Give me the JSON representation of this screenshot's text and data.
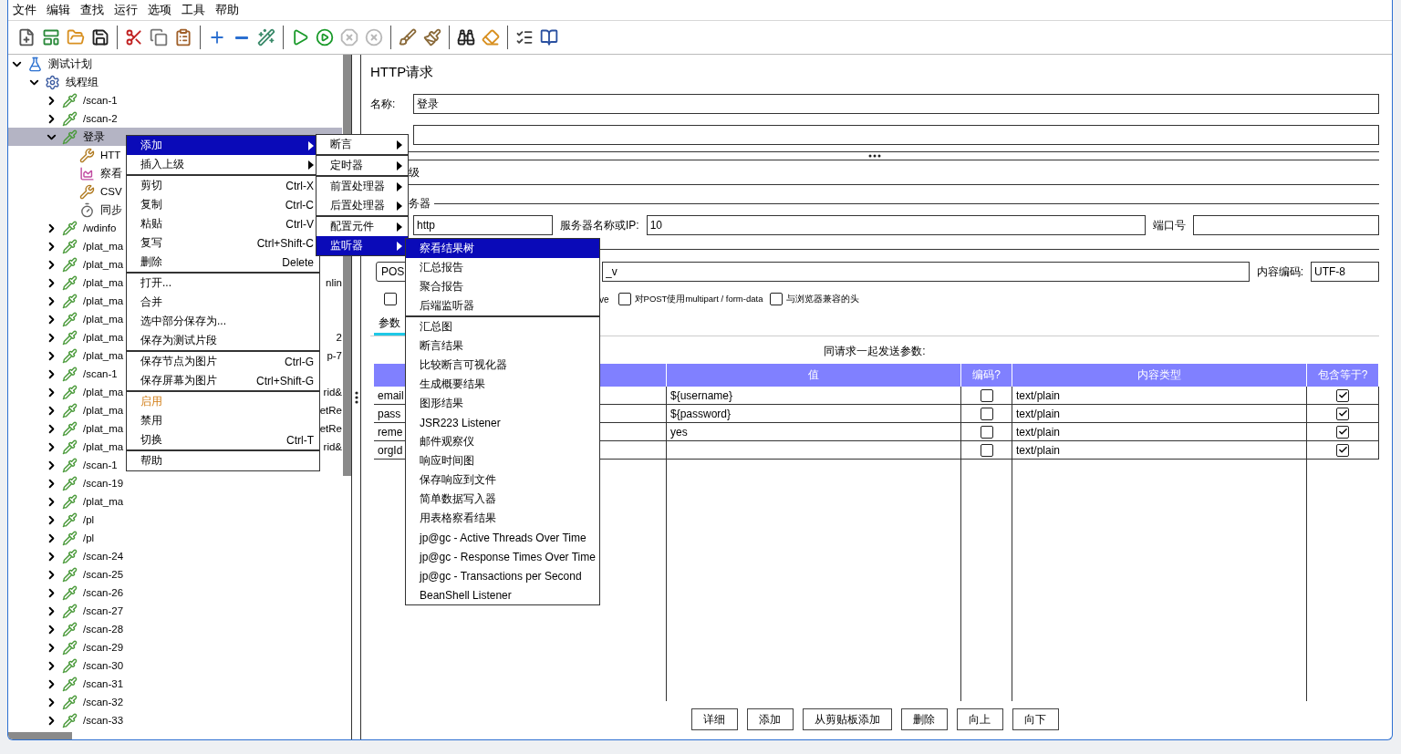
{
  "menu_bar": [
    "文件",
    "编辑",
    "查找",
    "运行",
    "选项",
    "工具",
    "帮助"
  ],
  "toolbar": {
    "groups": [
      [
        {
          "kind": "new",
          "disabled": false
        },
        {
          "kind": "templates",
          "disabled": false
        },
        {
          "kind": "open",
          "disabled": false
        },
        {
          "kind": "save",
          "disabled": false
        }
      ],
      [
        {
          "kind": "cut",
          "disabled": false
        },
        {
          "kind": "copy",
          "disabled": false
        },
        {
          "kind": "paste",
          "disabled": false
        }
      ],
      [
        {
          "kind": "expand",
          "disabled": false
        },
        {
          "kind": "collapse",
          "disabled": false
        },
        {
          "kind": "toggle",
          "disabled": false
        }
      ],
      [
        {
          "kind": "start",
          "disabled": false
        },
        {
          "kind": "start_no_timers",
          "disabled": false
        },
        {
          "kind": "stop",
          "disabled": true
        },
        {
          "kind": "shutdown",
          "disabled": true
        }
      ],
      [
        {
          "kind": "clear",
          "disabled": false
        },
        {
          "kind": "clear_all",
          "disabled": false
        }
      ],
      [
        {
          "kind": "search",
          "disabled": false
        },
        {
          "kind": "reset_search",
          "disabled": false
        }
      ],
      [
        {
          "kind": "functions",
          "disabled": false
        },
        {
          "kind": "help",
          "disabled": false
        }
      ]
    ]
  },
  "tree": [
    {
      "kind": "plan",
      "label": "测试计划",
      "expanded": true,
      "selected": false,
      "children": [
        {
          "kind": "threads",
          "label": "线程组",
          "expanded": true,
          "selected": false,
          "children": [
            {
              "kind": "sampler",
              "label": "/scan-1",
              "expanded": false,
              "selected": false
            },
            {
              "kind": "sampler",
              "label": "/scan-2",
              "expanded": false,
              "selected": false
            },
            {
              "kind": "sampler",
              "label": "登录",
              "expanded": true,
              "selected": true,
              "children": [
                {
                  "kind": "tool",
                  "label": "HTT",
                  "selected": false
                },
                {
                  "kind": "chart",
                  "label": "察看",
                  "selected": false
                },
                {
                  "kind": "tool",
                  "label": "CSV",
                  "selected": false
                },
                {
                  "kind": "timer",
                  "label": "同步",
                  "selected": false
                }
              ]
            },
            {
              "kind": "sampler",
              "label": "/wdinfo",
              "expanded": false,
              "selected": false
            },
            {
              "kind": "sampler",
              "label": "/plat_ma",
              "expanded": false,
              "selected": false
            },
            {
              "kind": "sampler",
              "label": "/plat_ma",
              "expanded": false,
              "selected": false
            },
            {
              "kind": "sampler",
              "label": "/plat_ma",
              "expanded": false,
              "selected": false,
              "tail": "nlin"
            },
            {
              "kind": "sampler",
              "label": "/plat_ma",
              "expanded": false,
              "selected": false
            },
            {
              "kind": "sampler",
              "label": "/plat_ma",
              "expanded": false,
              "selected": false
            },
            {
              "kind": "sampler",
              "label": "/plat_ma",
              "expanded": false,
              "selected": false,
              "tail": "2"
            },
            {
              "kind": "sampler",
              "label": "/plat_ma",
              "expanded": false,
              "selected": false,
              "tail": "p-7"
            },
            {
              "kind": "sampler",
              "label": "/scan-1",
              "expanded": false,
              "selected": false
            },
            {
              "kind": "sampler",
              "label": "/plat_ma",
              "expanded": false,
              "selected": false,
              "tail": "rid&"
            },
            {
              "kind": "sampler",
              "label": "/plat_ma",
              "expanded": false,
              "selected": false,
              "tail": "etRe"
            },
            {
              "kind": "sampler",
              "label": "/plat_ma",
              "expanded": false,
              "selected": false,
              "tail": "etRe"
            },
            {
              "kind": "sampler",
              "label": "/plat_ma",
              "expanded": false,
              "selected": false,
              "tail": "rid&"
            },
            {
              "kind": "sampler",
              "label": "/scan-1",
              "expanded": false,
              "selected": false
            },
            {
              "kind": "sampler",
              "label": "/scan-19",
              "expanded": false,
              "selected": false
            },
            {
              "kind": "sampler",
              "label": "/plat_ma",
              "expanded": false,
              "selected": false
            },
            {
              "kind": "sampler",
              "label": "/pl",
              "expanded": false,
              "selected": false
            },
            {
              "kind": "sampler",
              "label": "/pl",
              "expanded": false,
              "selected": false
            },
            {
              "kind": "sampler",
              "label": "/scan-24",
              "expanded": false,
              "selected": false
            },
            {
              "kind": "sampler",
              "label": "/scan-25",
              "expanded": false,
              "selected": false
            },
            {
              "kind": "sampler",
              "label": "/scan-26",
              "expanded": false,
              "selected": false
            },
            {
              "kind": "sampler",
              "label": "/scan-27",
              "expanded": false,
              "selected": false
            },
            {
              "kind": "sampler",
              "label": "/scan-28",
              "expanded": false,
              "selected": false
            },
            {
              "kind": "sampler",
              "label": "/scan-29",
              "expanded": false,
              "selected": false
            },
            {
              "kind": "sampler",
              "label": "/scan-30",
              "expanded": false,
              "selected": false
            },
            {
              "kind": "sampler",
              "label": "/scan-31",
              "expanded": false,
              "selected": false
            },
            {
              "kind": "sampler",
              "label": "/scan-32",
              "expanded": false,
              "selected": false
            },
            {
              "kind": "sampler",
              "label": "/scan-33",
              "expanded": false,
              "selected": false
            }
          ]
        }
      ]
    }
  ],
  "panel": {
    "title": "HTTP请求",
    "name_label": "名称:",
    "name_value": "登录",
    "tab_fragment": "级",
    "server_legend": "务器",
    "protocol": "http",
    "server_label": "服务器名称或IP:",
    "server_value": "10",
    "port_label": "端口号",
    "method": "POS",
    "path_value": "_v",
    "encoding_label": "内容编码:",
    "encoding_value": "UTF-8",
    "options": [
      {
        "checked": false
      },
      {
        "label": "对POST使用multipart / form-data",
        "checked": false
      },
      {
        "label": "与浏览器兼容的头",
        "checked": false
      }
    ],
    "option_fragment": "ve",
    "tabs": [
      {
        "label": "参数",
        "selected": true
      }
    ],
    "params_caption": "同请求一起发送参数:",
    "table": {
      "columns": [
        "",
        "值",
        "编码?",
        "内容类型",
        "包含等于?"
      ],
      "rows": [
        {
          "name": "email",
          "value": "${username}",
          "encode": false,
          "content_type": "text/plain",
          "include_equals": true
        },
        {
          "name": "pass",
          "value": "${password}",
          "encode": false,
          "content_type": "text/plain",
          "include_equals": true
        },
        {
          "name": "reme",
          "value": "yes",
          "encode": false,
          "content_type": "text/plain",
          "include_equals": true
        },
        {
          "name": "orgId",
          "value": "",
          "encode": false,
          "content_type": "text/plain",
          "include_equals": true
        }
      ]
    },
    "buttons": [
      "详细",
      "添加",
      "从剪贴板添加",
      "删除",
      "向上",
      "向下"
    ]
  },
  "context_menu": {
    "groups": [
      [
        {
          "label": "添加",
          "submenu": true,
          "selected": true,
          "disabled": false
        },
        {
          "label": "插入上级",
          "submenu": true,
          "selected": false,
          "disabled": false
        }
      ],
      [
        {
          "label": "剪切",
          "shortcut": "Ctrl-X",
          "submenu": false,
          "selected": false,
          "disabled": false
        },
        {
          "label": "复制",
          "shortcut": "Ctrl-C",
          "submenu": false,
          "selected": false,
          "disabled": false
        },
        {
          "label": "粘贴",
          "shortcut": "Ctrl-V",
          "submenu": false,
          "selected": false,
          "disabled": false
        },
        {
          "label": "复写",
          "shortcut": "Ctrl+Shift-C",
          "submenu": false,
          "selected": false,
          "disabled": false
        },
        {
          "label": "删除",
          "shortcut": "Delete",
          "submenu": false,
          "selected": false,
          "disabled": false
        }
      ],
      [
        {
          "label": "打开...",
          "submenu": false,
          "selected": false,
          "disabled": false
        },
        {
          "label": "合并",
          "submenu": false,
          "selected": false,
          "disabled": false
        },
        {
          "label": "选中部分保存为...",
          "submenu": false,
          "selected": false,
          "disabled": false
        },
        {
          "label": "保存为测试片段",
          "submenu": false,
          "selected": false,
          "disabled": false
        }
      ],
      [
        {
          "label": "保存节点为图片",
          "shortcut": "Ctrl-G",
          "submenu": false,
          "selected": false,
          "disabled": false
        },
        {
          "label": "保存屏幕为图片",
          "shortcut": "Ctrl+Shift-G",
          "submenu": false,
          "selected": false,
          "disabled": false
        }
      ],
      [
        {
          "label": "启用",
          "submenu": false,
          "selected": false,
          "disabled": true
        },
        {
          "label": "禁用",
          "submenu": false,
          "selected": false,
          "disabled": false
        },
        {
          "label": "切换",
          "shortcut": "Ctrl-T",
          "submenu": false,
          "selected": false,
          "disabled": false
        }
      ],
      [
        {
          "label": "帮助",
          "submenu": false,
          "selected": false,
          "disabled": false
        }
      ]
    ]
  },
  "add_submenu": {
    "groups": [
      [
        {
          "label": "断言",
          "submenu": true,
          "selected": false
        }
      ],
      [
        {
          "label": "定时器",
          "submenu": true,
          "selected": false
        }
      ],
      [
        {
          "label": "前置处理器",
          "submenu": true,
          "selected": false
        },
        {
          "label": "后置处理器",
          "submenu": true,
          "selected": false
        }
      ],
      [
        {
          "label": "配置元件",
          "submenu": true,
          "selected": false
        },
        {
          "label": "监听器",
          "submenu": true,
          "selected": true
        }
      ]
    ]
  },
  "listener_submenu": {
    "groups": [
      [
        {
          "label": "察看结果树",
          "selected": true
        },
        {
          "label": "汇总报告",
          "selected": false
        },
        {
          "label": "聚合报告",
          "selected": false
        },
        {
          "label": "后端监听器",
          "selected": false
        }
      ],
      [
        {
          "label": "汇总图",
          "selected": false
        },
        {
          "label": "断言结果",
          "selected": false
        },
        {
          "label": "比较断言可视化器",
          "selected": false
        },
        {
          "label": "生成概要结果",
          "selected": false
        },
        {
          "label": "图形结果",
          "selected": false
        },
        {
          "label": "JSR223 Listener",
          "selected": false
        },
        {
          "label": "邮件观察仪",
          "selected": false
        },
        {
          "label": "响应时间图",
          "selected": false
        },
        {
          "label": "保存响应到文件",
          "selected": false
        },
        {
          "label": "简单数据写入器",
          "selected": false
        },
        {
          "label": "用表格察看结果",
          "selected": false
        },
        {
          "label": "jp@gc - Active Threads Over Time",
          "selected": false
        },
        {
          "label": "jp@gc - Response Times Over Time",
          "selected": false
        },
        {
          "label": "jp@gc - Transactions per Second",
          "selected": false
        },
        {
          "label": "BeanShell Listener",
          "selected": false
        }
      ]
    ]
  }
}
